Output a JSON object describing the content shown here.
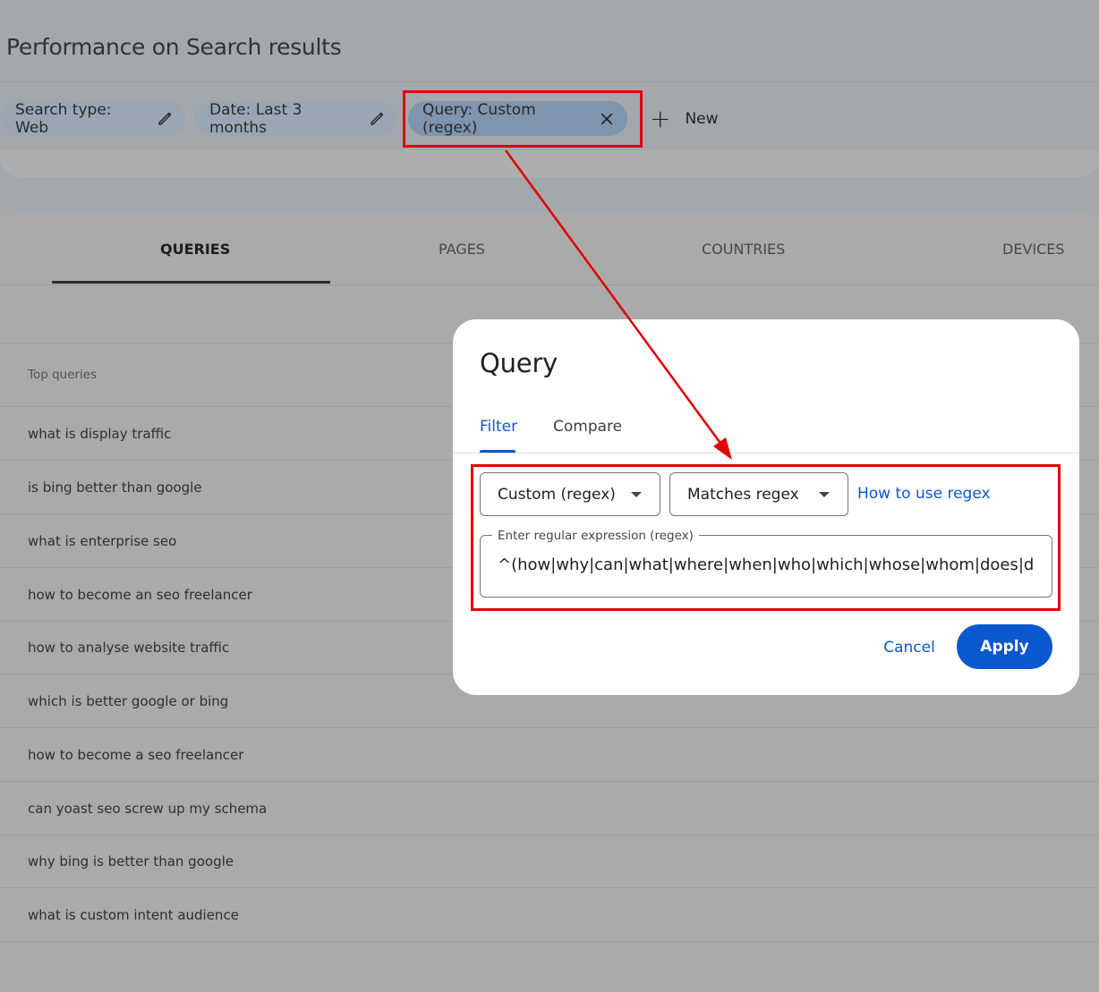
{
  "page": {
    "title": "Performance on Search results"
  },
  "chips": [
    {
      "label": "Search type: Web",
      "icon": "pencil-icon"
    },
    {
      "label": "Date: Last 3 months",
      "icon": "pencil-icon"
    },
    {
      "label": "Query: Custom (regex)",
      "icon": "close-icon"
    }
  ],
  "new_button": {
    "label": "New",
    "icon": "plus-icon"
  },
  "tabs": [
    {
      "label": "QUERIES",
      "active": true
    },
    {
      "label": "PAGES",
      "active": false
    },
    {
      "label": "COUNTRIES",
      "active": false
    },
    {
      "label": "DEVICES",
      "active": false
    }
  ],
  "table": {
    "header": "Top queries",
    "rows": [
      "what is display traffic",
      "is bing better than google",
      "what is enterprise seo",
      "how to become an seo freelancer",
      "how to analyse website traffic",
      "which is better google or bing",
      "how to become a seo freelancer",
      "can yoast seo screw up my schema",
      "why bing is better than google",
      "what is custom intent audience"
    ]
  },
  "dialog": {
    "title": "Query",
    "tabs": {
      "filter": "Filter",
      "compare": "Compare"
    },
    "type_select": "Custom (regex)",
    "match_select": "Matches regex",
    "help_link": "How to use regex",
    "regex_label": "Enter regular expression (regex)",
    "regex_value": "^(how|why|can|what|where|when|who|which|whose|whom|does|dc",
    "cancel": "Cancel",
    "apply": "Apply"
  },
  "colors": {
    "accent": "#0b57d0",
    "annotation": "#e00000"
  }
}
